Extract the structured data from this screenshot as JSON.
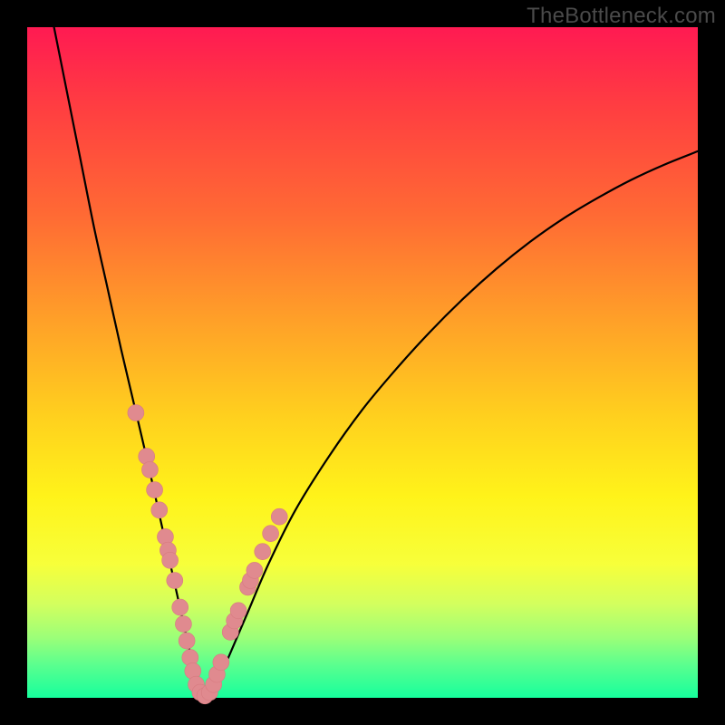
{
  "watermark": "TheBottleneck.com",
  "colors": {
    "curve_stroke": "#000000",
    "marker_fill": "#e08a8f",
    "marker_stroke": "#d77b80"
  },
  "chart_data": {
    "type": "line",
    "title": "",
    "xlabel": "",
    "ylabel": "",
    "xlim": [
      0,
      100
    ],
    "ylim": [
      0,
      100
    ],
    "series": [
      {
        "name": "bottleneck-curve",
        "x": [
          4,
          6,
          8,
          10,
          12,
          14,
          16,
          18,
          20,
          21,
          22,
          23,
          24,
          25,
          26,
          27,
          28,
          30,
          33,
          36,
          40,
          45,
          50,
          55,
          60,
          65,
          70,
          75,
          80,
          85,
          90,
          95,
          100
        ],
        "y": [
          100,
          90,
          80,
          70,
          61,
          52,
          43.5,
          35,
          26,
          21.5,
          17,
          12.5,
          8,
          4,
          1.2,
          0.3,
          1.5,
          6,
          13,
          20,
          28,
          36,
          43,
          49,
          54.5,
          59.5,
          64,
          68,
          71.5,
          74.5,
          77.2,
          79.5,
          81.5
        ]
      }
    ],
    "markers": [
      {
        "x": 16.2,
        "y": 42.5
      },
      {
        "x": 17.8,
        "y": 36.0
      },
      {
        "x": 18.3,
        "y": 34.0
      },
      {
        "x": 19.0,
        "y": 31.0
      },
      {
        "x": 19.7,
        "y": 28.0
      },
      {
        "x": 20.6,
        "y": 24.0
      },
      {
        "x": 21.0,
        "y": 22.0
      },
      {
        "x": 21.3,
        "y": 20.5
      },
      {
        "x": 22.0,
        "y": 17.5
      },
      {
        "x": 22.8,
        "y": 13.5
      },
      {
        "x": 23.3,
        "y": 11.0
      },
      {
        "x": 23.8,
        "y": 8.5
      },
      {
        "x": 24.3,
        "y": 6.0
      },
      {
        "x": 24.7,
        "y": 4.0
      },
      {
        "x": 25.2,
        "y": 2.0
      },
      {
        "x": 25.8,
        "y": 0.8
      },
      {
        "x": 26.5,
        "y": 0.3
      },
      {
        "x": 27.2,
        "y": 0.8
      },
      {
        "x": 27.8,
        "y": 2.0
      },
      {
        "x": 28.3,
        "y": 3.5
      },
      {
        "x": 28.9,
        "y": 5.3
      },
      {
        "x": 30.3,
        "y": 9.8
      },
      {
        "x": 30.9,
        "y": 11.5
      },
      {
        "x": 31.5,
        "y": 13.0
      },
      {
        "x": 32.9,
        "y": 16.5
      },
      {
        "x": 33.3,
        "y": 17.5
      },
      {
        "x": 33.9,
        "y": 19.0
      },
      {
        "x": 35.1,
        "y": 21.8
      },
      {
        "x": 36.3,
        "y": 24.5
      },
      {
        "x": 37.6,
        "y": 27.0
      }
    ]
  }
}
